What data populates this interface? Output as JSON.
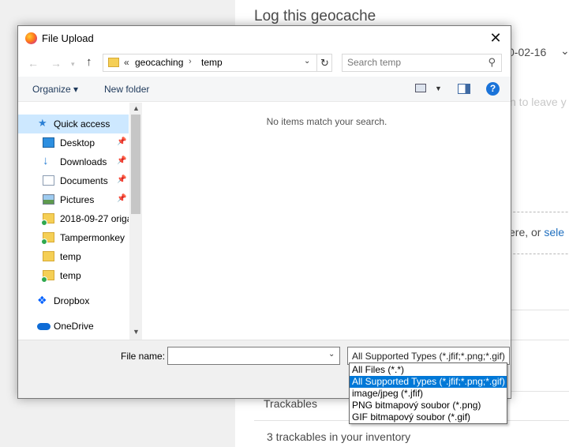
{
  "background_page": {
    "title": "Log this geocache",
    "date_fragment": "0-02-16",
    "hint_fragment": "n to leave y",
    "drop_fragment": "ere, or ",
    "drop_link": "sele",
    "trackables_heading": "Trackables",
    "inventory_text": "3 trackables in your inventory"
  },
  "dialog": {
    "title": "File Upload",
    "close_symbol": "✕",
    "address": {
      "prefix": "«",
      "segments": [
        "geocaching",
        "temp"
      ],
      "separator": "›"
    },
    "search": {
      "placeholder": "Search temp"
    },
    "toolbar": {
      "organize_label": "Organize ▾",
      "new_folder_label": "New folder",
      "help_label": "?"
    },
    "nav_items": [
      {
        "label": "Quick access",
        "icon": "star-icon"
      },
      {
        "label": "Desktop",
        "icon": "desktop-icon",
        "pinned": true
      },
      {
        "label": "Downloads",
        "icon": "downloads-icon",
        "pinned": true
      },
      {
        "label": "Documents",
        "icon": "documents-icon",
        "pinned": true
      },
      {
        "label": "Pictures",
        "icon": "pictures-icon",
        "pinned": true
      },
      {
        "label": "2018-09-27 origa",
        "icon": "folder-sync-icon"
      },
      {
        "label": "Tampermonkey",
        "icon": "folder-sync-icon"
      },
      {
        "label": "temp",
        "icon": "folder-icon"
      },
      {
        "label": "temp",
        "icon": "folder-sync-icon"
      },
      {
        "label": "Dropbox",
        "icon": "dropbox-icon"
      },
      {
        "label": "OneDrive",
        "icon": "onedrive-icon"
      }
    ],
    "empty_message": "No items match your search.",
    "file_name_label": "File name:",
    "file_name_value": "",
    "file_type_selected": "All Supported Types (*.jfif;*.png;*.gif)",
    "file_type_options": [
      "All Files (*.*)",
      "All Supported Types (*.jfif;*.png;*.gif)",
      "image/jpeg (*.jfif)",
      "PNG bitmapový soubor (*.png)",
      "GIF bitmapový soubor (*.gif)"
    ],
    "file_type_highlighted_index": 1
  },
  "colors": {
    "selection": "#0078d7",
    "nav_highlight": "#cde8ff",
    "link": "#1f6fbf"
  }
}
